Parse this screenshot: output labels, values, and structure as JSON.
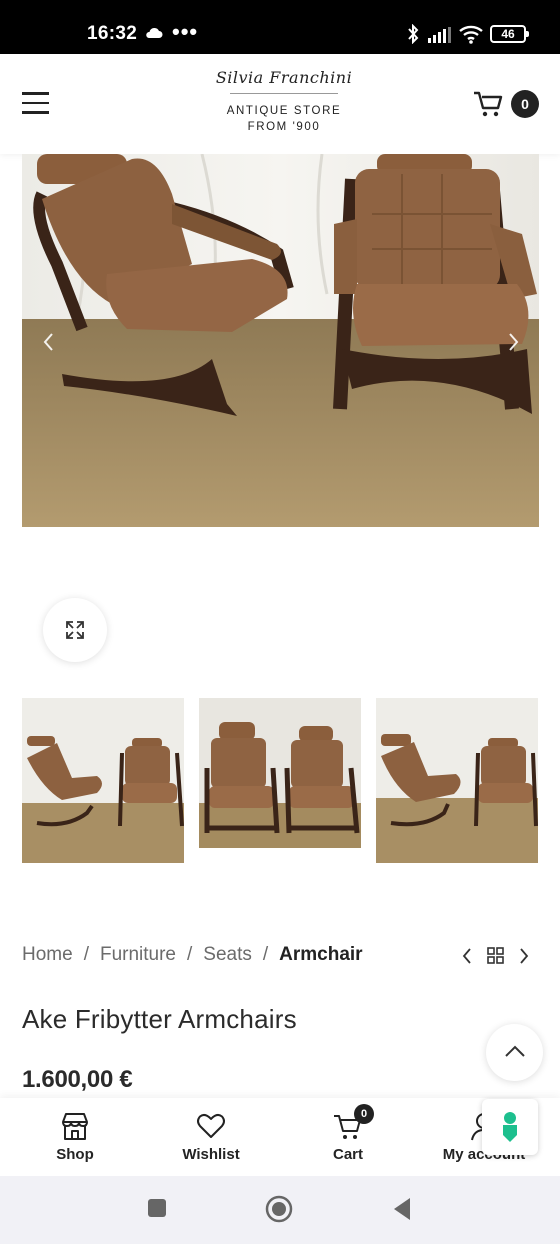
{
  "status_bar": {
    "time": "16:32",
    "dots": "•••",
    "battery": "46"
  },
  "header": {
    "logo_script": "Silvia Franchini",
    "logo_line1": "ANTIQUE STORE",
    "logo_line2": "FROM '900",
    "cart_count": "0"
  },
  "gallery": {
    "main_image": "two-brown-bentwood-armchairs-photo",
    "thumbnails": [
      "armchairs-photo-1",
      "armchairs-photo-2",
      "armchairs-photo-3"
    ]
  },
  "breadcrumb": {
    "items": [
      "Home",
      "Furniture",
      "Seats"
    ],
    "separator": "/",
    "current": "Armchair"
  },
  "product": {
    "title": "Ake Fribytter Armchairs",
    "price": "1.600,00 €"
  },
  "toolbar": {
    "shop_label": "Shop",
    "wishlist_label": "Wishlist",
    "cart_label": "Cart",
    "cart_count": "0",
    "account_label": "My account"
  },
  "colors": {
    "accent_dark": "#222222",
    "chat_green": "#1dbf8e"
  },
  "icons": [
    "cloud-icon",
    "bluetooth-icon",
    "signal-icon",
    "wifi-icon",
    "battery-icon",
    "menu-icon",
    "cart-icon",
    "chevron-left-icon",
    "chevron-right-icon",
    "expand-icon",
    "grid-icon",
    "chevron-up-icon",
    "shop-icon",
    "heart-icon",
    "user-icon",
    "chat-icon",
    "square-icon",
    "circle-icon",
    "triangle-back-icon"
  ]
}
